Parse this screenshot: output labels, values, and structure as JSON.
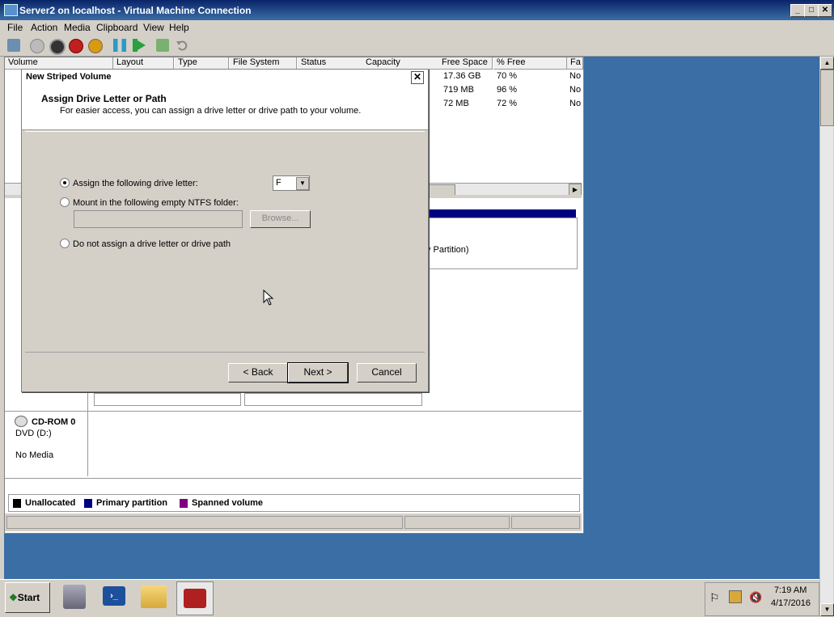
{
  "window": {
    "title": "Server2 on localhost - Virtual Machine Connection"
  },
  "menu": [
    "File",
    "Action",
    "Media",
    "Clipboard",
    "View",
    "Help"
  ],
  "toolbar_icons": [
    "ctrl-alt-del-icon",
    "start-icon",
    "turn-off-icon",
    "shutdown-icon",
    "save-state-icon",
    "pause-icon",
    "resume-icon",
    "snapshot-icon",
    "revert-icon"
  ],
  "volume_columns": [
    "Volume",
    "Layout",
    "Type",
    "File System",
    "Status",
    "Capacity",
    "Free Space",
    "% Free",
    "Fa"
  ],
  "volume_rows": [
    {
      "free": "17.36 GB",
      "pct": "70 %",
      "fa": "No"
    },
    {
      "free": "719 MB",
      "pct": "96 %",
      "fa": "No"
    },
    {
      "free": "72 MB",
      "pct": "72 %",
      "fa": "No"
    }
  ],
  "disk_panel": {
    "partition_text": "y Partition)"
  },
  "cdrom": {
    "name": "CD-ROM 0",
    "drive": "DVD (D:)",
    "status": "No Media"
  },
  "legend": [
    {
      "label": "Unallocated",
      "color": "#000000"
    },
    {
      "label": "Primary partition",
      "color": "#000080"
    },
    {
      "label": "Spanned volume",
      "color": "#800080"
    }
  ],
  "dialog": {
    "title": "New Striped Volume",
    "heading": "Assign Drive Letter or Path",
    "subheading": "For easier access, you can assign a drive letter or drive path to your volume.",
    "opt_letter": "Assign the following drive letter:",
    "drive_letter": "F",
    "opt_folder": "Mount in the following empty NTFS folder:",
    "browse": "Browse...",
    "opt_none": "Do not assign a drive letter or drive path",
    "back": "< Back",
    "next": "Next >",
    "cancel": "Cancel"
  },
  "taskbar": {
    "start": "Start",
    "time": "7:19 AM",
    "date": "4/17/2016"
  }
}
